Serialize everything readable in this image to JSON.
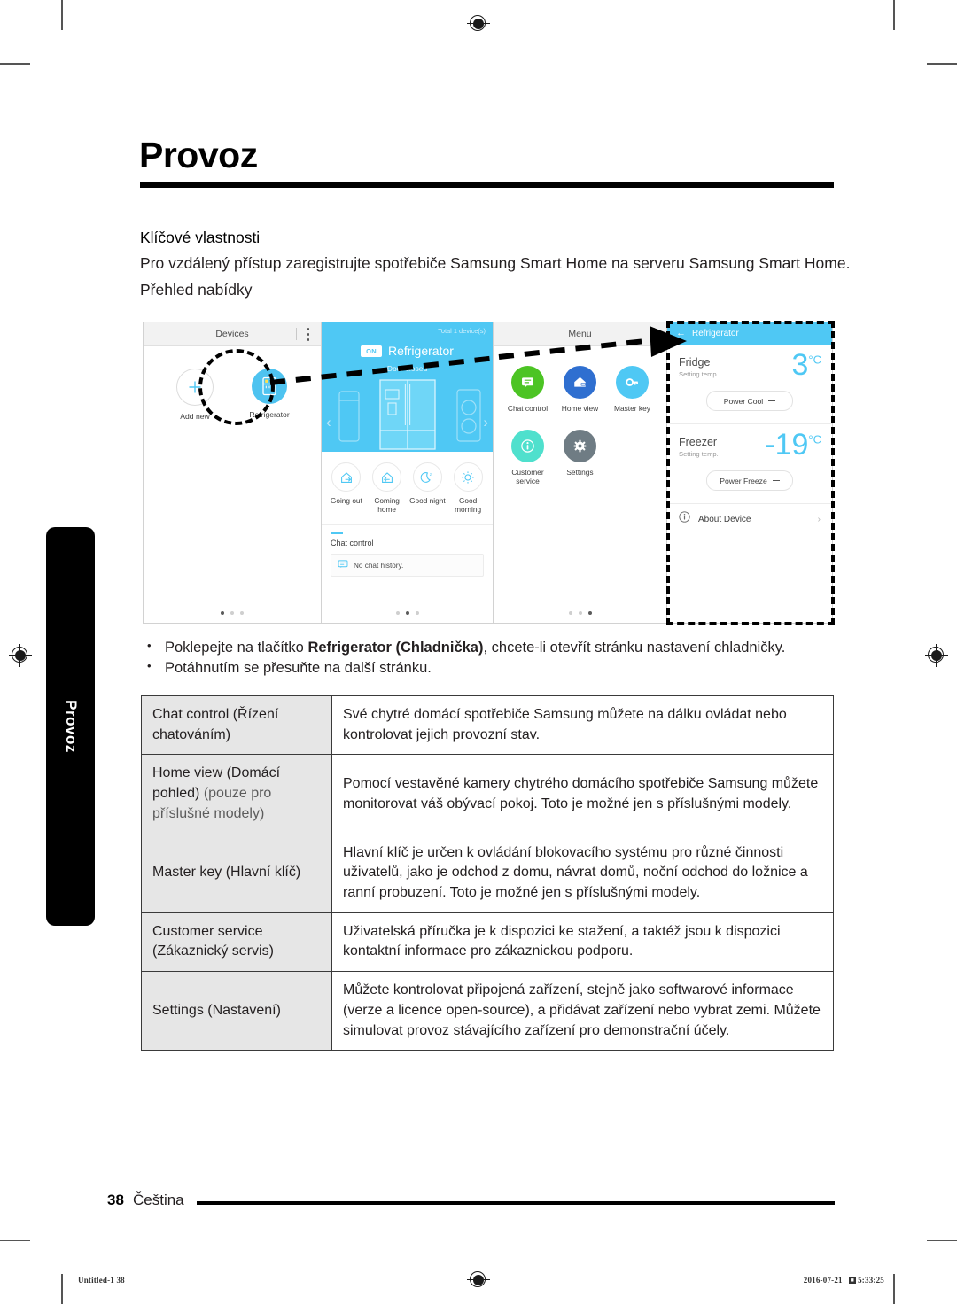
{
  "document": {
    "chapter_title": "Provoz",
    "side_tab_label": "Provoz",
    "section_heading": "Klíčové vlastnosti",
    "intro_paragraph": "Pro vzdálený přístup zaregistrujte spotřebiče Samsung Smart Home na serveru Samsung Smart Home.",
    "subheading": "Přehled nabídky"
  },
  "screens": {
    "devices": {
      "header_title": "Devices",
      "menu_icon": "kebab-menu-icon",
      "items": [
        {
          "label": "Add new",
          "icon": "plus-icon"
        },
        {
          "label": "Refrigerator",
          "icon": "refrigerator-icon"
        }
      ],
      "pager": {
        "count": 3,
        "active": 0
      }
    },
    "device_detail": {
      "total_devices": "Total 1 device(s)",
      "power_state": "ON",
      "device_name": "Refrigerator",
      "status": "Door closed",
      "prev_arrow": "chevron-left-icon",
      "next_arrow": "chevron-right-icon",
      "quick_actions": [
        {
          "label": "Going out",
          "icon": "house-arrow-out-icon"
        },
        {
          "label": "Coming home",
          "icon": "house-arrow-in-icon"
        },
        {
          "label": "Good night",
          "icon": "moon-icon"
        },
        {
          "label": "Good morning",
          "icon": "sun-icon"
        }
      ],
      "chat_section_title": "Chat control",
      "chat_empty_message": "No chat history.",
      "chat_empty_icon": "chat-bubble-icon",
      "pager": {
        "count": 3,
        "active": 1
      }
    },
    "menu": {
      "header_title": "Menu",
      "menu_icon": "kebab-menu-icon",
      "items": [
        {
          "label": "Chat control",
          "icon": "chat-bubble-icon",
          "color": "#4cc424"
        },
        {
          "label": "Home view",
          "icon": "home-camera-icon",
          "color": "#2f6fd0"
        },
        {
          "label": "Master key",
          "icon": "key-icon",
          "color": "#4fc8f4"
        },
        {
          "label": "Customer service",
          "icon": "info-icon",
          "color": "#4fe0cd"
        },
        {
          "label": "Settings",
          "icon": "gear-icon",
          "color": "#6f7c84"
        }
      ],
      "pager": {
        "count": 3,
        "active": 2
      }
    },
    "refrigerator_settings": {
      "back_icon": "arrow-left-icon",
      "header_title": "Refrigerator",
      "zones": [
        {
          "name": "Fridge",
          "sub": "Setting temp.",
          "value": "3",
          "unit": "°C",
          "button_label": "Power Cool"
        },
        {
          "name": "Freezer",
          "sub": "Setting temp.",
          "value": "-19",
          "unit": "°C",
          "button_label": "Power Freeze"
        }
      ],
      "about_label": "About Device",
      "about_icon": "info-icon",
      "about_chevron": "chevron-right-icon"
    }
  },
  "bullets": [
    {
      "prefix": "Poklepejte na tlačítko ",
      "bold": "Refrigerator (Chladnička)",
      "suffix": ", chcete-li otevřít stránku nastavení chladničky."
    },
    {
      "prefix": "Potáhnutím se přesuňte na další stránku.",
      "bold": "",
      "suffix": ""
    }
  ],
  "table": {
    "rows": [
      {
        "key_main": "Chat control (Řízení chatováním)",
        "key_note": "",
        "description": "Své chytré domácí spotřebiče Samsung můžete na dálku ovládat nebo kontrolovat jejich provozní stav."
      },
      {
        "key_main": "Home view (Domácí pohled) ",
        "key_note": "(pouze pro příslušné modely)",
        "description": "Pomocí vestavěné kamery chytrého domácího spotřebiče Samsung můžete monitorovat váš obývací pokoj. Toto je možné jen s příslušnými modely."
      },
      {
        "key_main": "Master key (Hlavní klíč)",
        "key_note": "",
        "description": "Hlavní klíč je určen k ovládání blokovacího systému pro různé činnosti uživatelů, jako je odchod z domu, návrat domů, noční odchod do ložnice a ranní probuzení. Toto je možné jen s příslušnými modely."
      },
      {
        "key_main": "Customer service (Zákaznický servis)",
        "key_note": "",
        "description": "Uživatelská příručka je k dispozici ke stažení, a taktéž jsou k dispozici kontaktní informace pro zákaznickou podporu."
      },
      {
        "key_main": "Settings (Nastavení)",
        "key_note": "",
        "description": "Můžete kontrolovat připojená zařízení, stejně jako softwarové informace (verze a licence open-source), a přidávat zařízení nebo vybrat zemi. Můžete simulovat provoz stávajícího zařízení pro demonstrační účely."
      }
    ]
  },
  "footer": {
    "page_number": "38",
    "language": "Čeština",
    "print_job": "Untitled-1   38",
    "print_date": "2016-07-21",
    "print_time": "5:33:25"
  },
  "colors": {
    "accent_blue": "#4fc8f4",
    "table_key_bg": "#e6e6e6",
    "rule_black": "#000000"
  }
}
